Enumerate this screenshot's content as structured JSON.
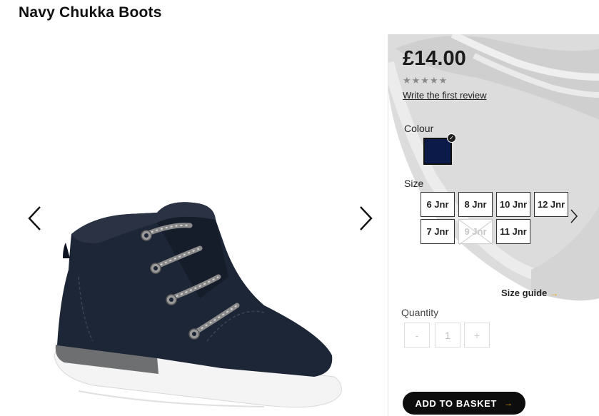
{
  "product": {
    "title": "Navy Chukka Boots",
    "price": "£14.00",
    "rating_stars": "★★★★★",
    "review_link": "Write the first review"
  },
  "colour": {
    "label": "Colour",
    "swatch_color": "#0c1a4a",
    "selected_icon": "check-icon"
  },
  "size": {
    "label": "Size",
    "options": [
      {
        "label": "6 Jnr",
        "available": true
      },
      {
        "label": "8 Jnr",
        "available": true
      },
      {
        "label": "10 Jnr",
        "available": true
      },
      {
        "label": "12 Jnr",
        "available": true
      },
      {
        "label": "7 Jnr",
        "available": true
      },
      {
        "label": "9 Jnr",
        "available": false
      },
      {
        "label": "11 Jnr",
        "available": true
      }
    ],
    "guide_label": "Size guide",
    "guide_icon": "arrow-right-icon"
  },
  "quantity": {
    "label": "Quantity",
    "minus": "-",
    "value": "1",
    "plus": "+"
  },
  "basket": {
    "label": "ADD TO BASKET",
    "icon": "arrow-right-icon"
  },
  "colors": {
    "accent": "#f0a500",
    "button": "#0d0d0d"
  }
}
